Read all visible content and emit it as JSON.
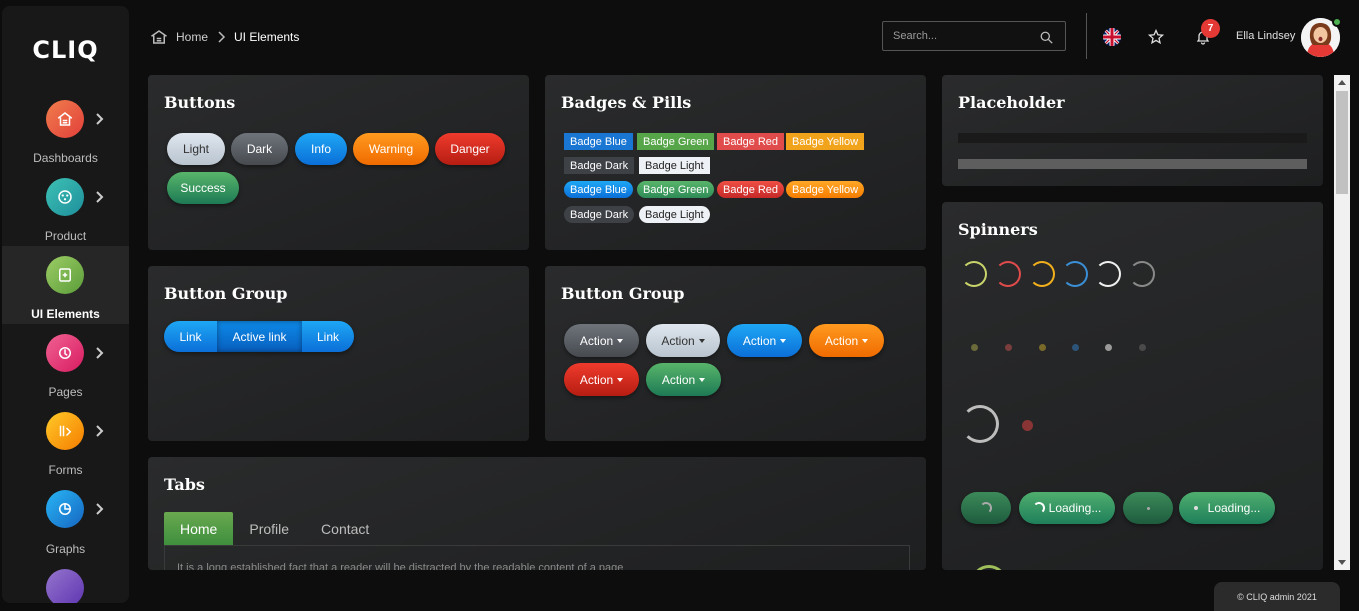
{
  "brand": {
    "logo": "CLIQ"
  },
  "sidebar": {
    "items": [
      {
        "label": "Dashboards",
        "icon": "home-icon",
        "color": "#e8563a"
      },
      {
        "label": "Product",
        "icon": "box-icon",
        "color": "#2aa7a0"
      },
      {
        "label": "UI Elements",
        "icon": "ui-elements-icon",
        "color": "#7cb342",
        "active": true
      },
      {
        "label": "Pages",
        "icon": "pages-icon",
        "color": "#ec407a"
      },
      {
        "label": "Forms",
        "icon": "forms-icon",
        "color": "#f9a825"
      },
      {
        "label": "Graphs",
        "icon": "graph-icon",
        "color": "#1e88e5"
      }
    ]
  },
  "header": {
    "breadcrumb": {
      "home": "Home",
      "current": "UI Elements"
    },
    "search_placeholder": "Search...",
    "notification_count": "7",
    "user_name": "Ella Lindsey"
  },
  "cards": {
    "buttons": {
      "title": "Buttons",
      "items": [
        "Light",
        "Dark",
        "Info",
        "Warning",
        "Danger",
        "Success"
      ]
    },
    "badges": {
      "title": "Badges & Pills",
      "square": [
        "Badge Blue",
        "Badge Green",
        "Badge Red",
        "Badge Yellow",
        "Badge Dark",
        "Badge Light"
      ],
      "pill": [
        "Badge Blue",
        "Badge Green",
        "Badge Red",
        "Badge Yellow",
        "Badge Dark",
        "Badge Light"
      ]
    },
    "placeholder": {
      "title": "Placeholder"
    },
    "button_group": {
      "title": "Button Group",
      "items": [
        "Link",
        "Active link",
        "Link"
      ]
    },
    "dropdown_group": {
      "title": "Button Group",
      "items": [
        "Action",
        "Action",
        "Action",
        "Action",
        "Action",
        "Action"
      ]
    },
    "spinners": {
      "title": "Spinners",
      "loading_labels": [
        "Loading...",
        "Loading..."
      ]
    },
    "tabs": {
      "title": "Tabs",
      "items": [
        "Home",
        "Profile",
        "Contact"
      ],
      "content": "It is a long established fact that a reader will be distracted by the readable content of a page"
    }
  },
  "footer": {
    "text": "© CLIQ admin 2021"
  },
  "colors": {
    "blue": "#1e88e5",
    "green": "#43a047",
    "red": "#e53935",
    "yellow": "#f9a825"
  }
}
